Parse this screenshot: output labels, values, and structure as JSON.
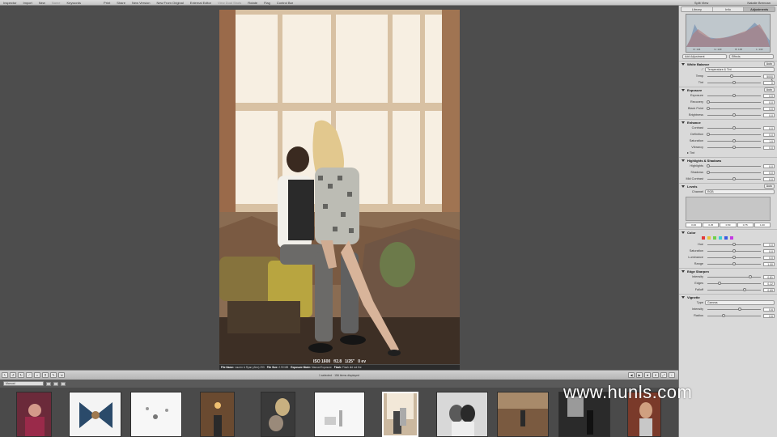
{
  "toolbar": {
    "left_items": [
      "Inspector",
      "Import",
      "New",
      "Name",
      "Keywords"
    ],
    "center_items": [
      "Print",
      "Share",
      "New Version",
      "New From Original",
      "External Editor",
      "View Dual Shots",
      "Rotate",
      "Flag",
      "Control Bar"
    ],
    "dimmed": [
      "Name",
      "View Dual Shots"
    ],
    "view_label": "Split View",
    "user_label": "Natalie Brennan"
  },
  "inspector": {
    "tabs": [
      "Library",
      "Info",
      "Adjustments"
    ],
    "active_tab": "Adjustments",
    "histogram_readout": [
      "R: 144",
      "G: 129",
      "B: 105",
      "L: 133"
    ],
    "presets_label": "Add Adjustment",
    "effects_label": "Effects",
    "white_balance": {
      "title": "White Balance",
      "auto": "Auto",
      "mode": "Temperature & Tint",
      "rows": [
        {
          "label": "Temp",
          "value": "5000 K",
          "level": 0.45
        },
        {
          "label": "Tint",
          "value": "0",
          "level": 0.5
        }
      ]
    },
    "exposure": {
      "title": "Exposure",
      "auto": "Auto",
      "rows": [
        {
          "label": "Exposure",
          "value": "0.0",
          "level": 0.5
        },
        {
          "label": "Recovery",
          "value": "0.0",
          "level": 0.02
        },
        {
          "label": "Black Point",
          "value": "0.0",
          "level": 0.02
        },
        {
          "label": "Brightness",
          "value": "0.0",
          "level": 0.5
        }
      ]
    },
    "enhance": {
      "title": "Enhance",
      "rows": [
        {
          "label": "Contrast",
          "value": "0.0",
          "level": 0.5
        },
        {
          "label": "Definition",
          "value": "0.0",
          "level": 0.02
        },
        {
          "label": "Saturation",
          "value": "1.0",
          "level": 0.5
        },
        {
          "label": "Vibrancy",
          "value": "0.0",
          "level": 0.5
        }
      ],
      "sub": "Tint"
    },
    "highlights_shadows": {
      "title": "Highlights & Shadows",
      "rows": [
        {
          "label": "Highlights",
          "value": "0.0",
          "level": 0.02
        },
        {
          "label": "Shadows",
          "value": "0.0",
          "level": 0.02
        },
        {
          "label": "Mid Contrast",
          "value": "0.0",
          "level": 0.5
        }
      ]
    },
    "levels": {
      "title": "Levels",
      "auto_luma": "Auto",
      "auto_rgb": "Auto",
      "channel_label": "Channel",
      "channel_value": "RGB",
      "values": [
        "0.00",
        "0.25",
        "0.50",
        "0.75",
        "1.00"
      ]
    },
    "color": {
      "title": "Color",
      "swatches": [
        "#e23a3a",
        "#e8c53a",
        "#6fd04a",
        "#3ad0d0",
        "#3a5ae2",
        "#c43ae2"
      ],
      "rows": [
        {
          "label": "Hue",
          "value": "0.0",
          "level": 0.5
        },
        {
          "label": "Saturation",
          "value": "0.0",
          "level": 0.5
        },
        {
          "label": "Luminance",
          "value": "0.0",
          "level": 0.5
        },
        {
          "label": "Range",
          "value": "1.00",
          "level": 0.5
        }
      ]
    },
    "edge_sharpen": {
      "title": "Edge Sharpen",
      "rows": [
        {
          "label": "Intensity",
          "value": "0.81",
          "level": 0.8
        },
        {
          "label": "Edges",
          "value": "0.22",
          "level": 0.22
        },
        {
          "label": "Falloff",
          "value": "0.69",
          "level": 0.69
        }
      ]
    },
    "vignette": {
      "title": "Vignette",
      "type_label": "Type",
      "type_value": "Gamma",
      "rows": [
        {
          "label": "Intensity",
          "value": "0.6",
          "level": 0.6
        },
        {
          "label": "Radius",
          "value": "0.6",
          "level": 0.3
        }
      ]
    }
  },
  "photo": {
    "hud": [
      "ISO 1600",
      "f/2.8",
      "1/25\"",
      "0 ev"
    ],
    "meta": [
      {
        "k": "File Name:",
        "v": "Lauren & Ryan (Alex) 293"
      },
      {
        "k": "File Size:",
        "v": "2.90 MB"
      },
      {
        "k": "Exposure Mode:",
        "v": "Manual Exposure"
      },
      {
        "k": "Flash:",
        "v": "Flash did not fire"
      }
    ]
  },
  "browser": {
    "status": "1 selected · 156 items displayed",
    "sort_label": "Manual"
  },
  "watermark": "www.hunls.com"
}
